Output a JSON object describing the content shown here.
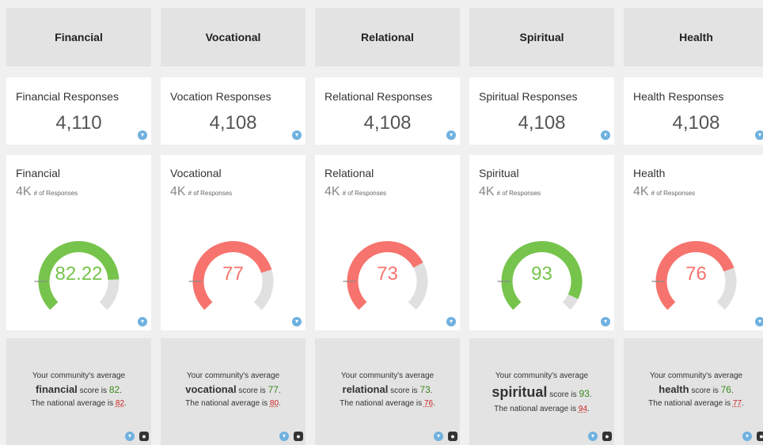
{
  "columns": [
    {
      "header": "Financial",
      "responses_title": "Financial Responses",
      "responses_value": "4,110",
      "gauge_title": "Financial",
      "gauge_sub": "4K",
      "gauge_sub_label": "# of Responses",
      "gauge_value": "82.22",
      "gauge_fraction": 0.8222,
      "gauge_color": "#76c44c",
      "summary_line1": "Your community's average",
      "summary_word": "financial",
      "summary_score_label": "score is",
      "summary_score": "82",
      "summary_nat_label": "The national average is",
      "summary_nat": "82"
    },
    {
      "header": "Vocational",
      "responses_title": "Vocation Responses",
      "responses_value": "4,108",
      "gauge_title": "Vocational",
      "gauge_sub": "4K",
      "gauge_sub_label": "# of Responses",
      "gauge_value": "77",
      "gauge_fraction": 0.77,
      "gauge_color": "#f7736d",
      "summary_line1": "Your community's average",
      "summary_word": "vocational",
      "summary_score_label": "score is",
      "summary_score": "77",
      "summary_nat_label": "The national average is",
      "summary_nat": "80"
    },
    {
      "header": "Relational",
      "responses_title": "Relational Responses",
      "responses_value": "4,108",
      "gauge_title": "Relational",
      "gauge_sub": "4K",
      "gauge_sub_label": "# of Responses",
      "gauge_value": "73",
      "gauge_fraction": 0.73,
      "gauge_color": "#f7736d",
      "summary_line1": "Your community's average",
      "summary_word": "relational",
      "summary_score_label": "score is",
      "summary_score": "73",
      "summary_nat_label": "The national average is",
      "summary_nat": "76"
    },
    {
      "header": "Spiritual",
      "responses_title": "Spiritual Responses",
      "responses_value": "4,108",
      "gauge_title": "Spiritual",
      "gauge_sub": "4K",
      "gauge_sub_label": "# of Responses",
      "gauge_value": "93",
      "gauge_fraction": 0.93,
      "gauge_color": "#76c44c",
      "summary_line1": "Your community's average",
      "summary_word": "spiritual",
      "summary_score_label": "score is",
      "summary_score": "93",
      "summary_nat_label": "The national average is",
      "summary_nat": "94"
    },
    {
      "header": "Health",
      "responses_title": "Health Responses",
      "responses_value": "4,108",
      "gauge_title": "Health",
      "gauge_sub": "4K",
      "gauge_sub_label": "# of Responses",
      "gauge_value": "76",
      "gauge_fraction": 0.76,
      "gauge_color": "#f7736d",
      "summary_line1": "Your community's average",
      "summary_word": "health",
      "summary_score_label": "score is",
      "summary_score": "76",
      "summary_nat_label": "The national average is",
      "summary_nat": "77"
    }
  ],
  "icons": {
    "filter_icon": "filter-icon",
    "person_icon": "person-icon"
  },
  "colors": {
    "gauge_track": "#e0e0e0",
    "green": "#76c44c",
    "red": "#f7736d",
    "score_green": "#3a8a1f",
    "national_red": "#cc2222"
  }
}
